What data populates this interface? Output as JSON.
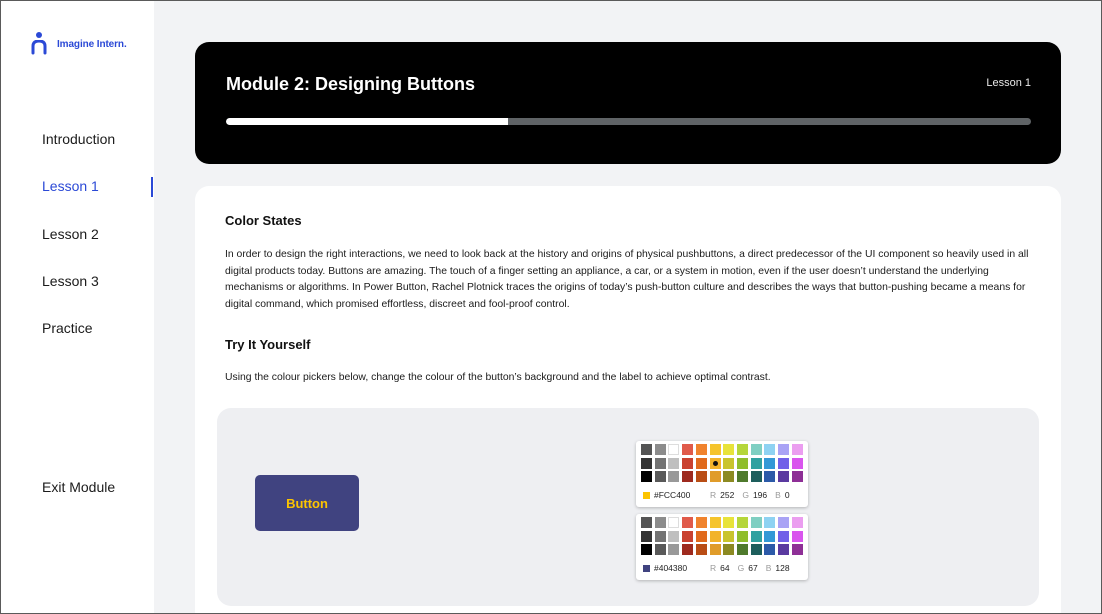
{
  "sidebar": {
    "logo_text": "Imagine Intern.",
    "items": [
      {
        "label": "Introduction"
      },
      {
        "label": "Lesson 1"
      },
      {
        "label": "Lesson 2"
      },
      {
        "label": "Lesson 3"
      },
      {
        "label": "Practice"
      }
    ],
    "active": "Lesson 1",
    "exit_label": "Exit Module"
  },
  "header": {
    "title": "Module 2: Designing Buttons",
    "lesson": "Lesson 1",
    "progress": 0.35
  },
  "content": {
    "heading": "Color States",
    "paragraph": "In order to design the right interactions, we need to look back at the history and origins of physical pushbuttons, a direct predecessor of the UI component so heavily used in all digital products today. Buttons are amazing. The touch of a finger setting an appliance, a car, or a system in motion, even if the user doesn’t understand the underlying mechanisms or algorithms. In Power Button, Rachel Plotnick traces the origins of today’s push-button culture and describes the ways that button-pushing became a means for digital command, which promised effortless, discreet and fool-proof control.",
    "try_heading": "Try It Yourself",
    "instructions": "Using the colour pickers below, change the colour of the button’s background and the label to achieve optimal contrast."
  },
  "demo": {
    "button_label": "Button",
    "button_bg": "#404380",
    "button_fg": "#FCC400"
  },
  "palette": [
    [
      "#545454",
      "#8c8c8c",
      "#ffffff",
      "#e05a4a",
      "#f0832d",
      "#f5c42c",
      "#e8e33a",
      "#b5d63a",
      "#7fcfc2",
      "#8ed2f2",
      "#a9a3f5",
      "#eb9ef0"
    ],
    [
      "#333333",
      "#737373",
      "#bfbfbf",
      "#c9412f",
      "#e06a1c",
      "#f2b32a",
      "#c9c42b",
      "#8fbd2b",
      "#2fa1a0",
      "#3398d6",
      "#7160e8",
      "#d955ee"
    ],
    [
      "#000000",
      "#595959",
      "#999999",
      "#9e2a1e",
      "#b94d15",
      "#e09c2a",
      "#8c8a22",
      "#4f7a2c",
      "#1d5e5c",
      "#2c5aa8",
      "#5a3aa0",
      "#8e2f96"
    ]
  ],
  "pickers": [
    {
      "selected": [
        1,
        5
      ],
      "chip": "#FCC400",
      "hex": "#FCC400",
      "r": "252",
      "g": "196",
      "b": "0"
    },
    {
      "selected": null,
      "chip": "#404380",
      "hex": "#404380",
      "r": "64",
      "g": "67",
      "b": "128"
    }
  ],
  "labels": {
    "r": "R",
    "g": "G",
    "b": "B"
  }
}
